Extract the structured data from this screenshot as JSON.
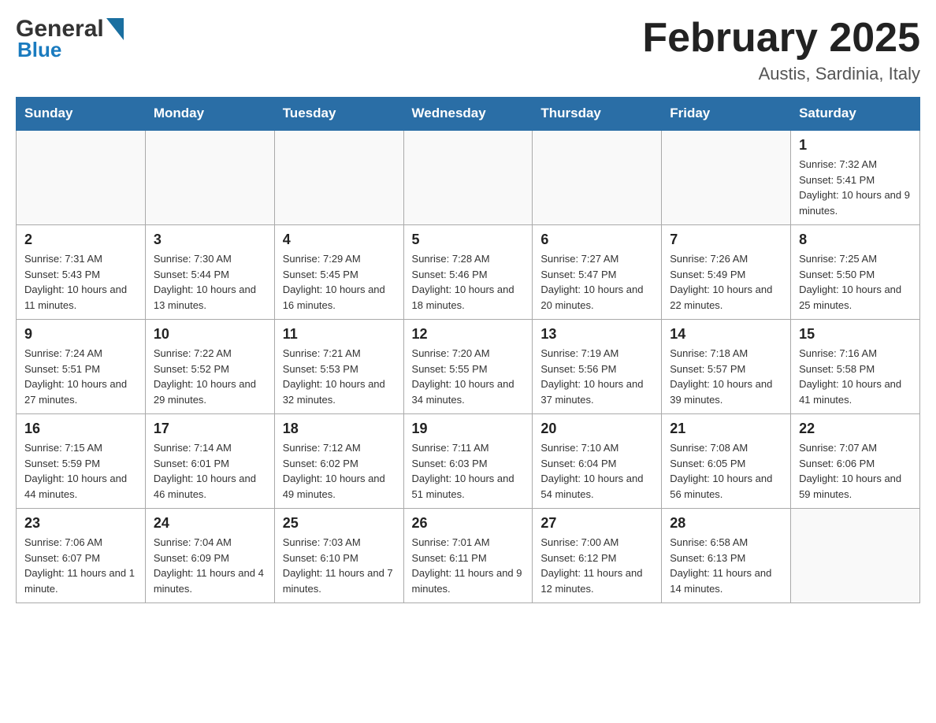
{
  "header": {
    "logo_general": "General",
    "logo_blue": "Blue",
    "month_title": "February 2025",
    "location": "Austis, Sardinia, Italy"
  },
  "weekdays": [
    "Sunday",
    "Monday",
    "Tuesday",
    "Wednesday",
    "Thursday",
    "Friday",
    "Saturday"
  ],
  "weeks": [
    [
      {
        "day": "",
        "info": ""
      },
      {
        "day": "",
        "info": ""
      },
      {
        "day": "",
        "info": ""
      },
      {
        "day": "",
        "info": ""
      },
      {
        "day": "",
        "info": ""
      },
      {
        "day": "",
        "info": ""
      },
      {
        "day": "1",
        "info": "Sunrise: 7:32 AM\nSunset: 5:41 PM\nDaylight: 10 hours and 9 minutes."
      }
    ],
    [
      {
        "day": "2",
        "info": "Sunrise: 7:31 AM\nSunset: 5:43 PM\nDaylight: 10 hours and 11 minutes."
      },
      {
        "day": "3",
        "info": "Sunrise: 7:30 AM\nSunset: 5:44 PM\nDaylight: 10 hours and 13 minutes."
      },
      {
        "day": "4",
        "info": "Sunrise: 7:29 AM\nSunset: 5:45 PM\nDaylight: 10 hours and 16 minutes."
      },
      {
        "day": "5",
        "info": "Sunrise: 7:28 AM\nSunset: 5:46 PM\nDaylight: 10 hours and 18 minutes."
      },
      {
        "day": "6",
        "info": "Sunrise: 7:27 AM\nSunset: 5:47 PM\nDaylight: 10 hours and 20 minutes."
      },
      {
        "day": "7",
        "info": "Sunrise: 7:26 AM\nSunset: 5:49 PM\nDaylight: 10 hours and 22 minutes."
      },
      {
        "day": "8",
        "info": "Sunrise: 7:25 AM\nSunset: 5:50 PM\nDaylight: 10 hours and 25 minutes."
      }
    ],
    [
      {
        "day": "9",
        "info": "Sunrise: 7:24 AM\nSunset: 5:51 PM\nDaylight: 10 hours and 27 minutes."
      },
      {
        "day": "10",
        "info": "Sunrise: 7:22 AM\nSunset: 5:52 PM\nDaylight: 10 hours and 29 minutes."
      },
      {
        "day": "11",
        "info": "Sunrise: 7:21 AM\nSunset: 5:53 PM\nDaylight: 10 hours and 32 minutes."
      },
      {
        "day": "12",
        "info": "Sunrise: 7:20 AM\nSunset: 5:55 PM\nDaylight: 10 hours and 34 minutes."
      },
      {
        "day": "13",
        "info": "Sunrise: 7:19 AM\nSunset: 5:56 PM\nDaylight: 10 hours and 37 minutes."
      },
      {
        "day": "14",
        "info": "Sunrise: 7:18 AM\nSunset: 5:57 PM\nDaylight: 10 hours and 39 minutes."
      },
      {
        "day": "15",
        "info": "Sunrise: 7:16 AM\nSunset: 5:58 PM\nDaylight: 10 hours and 41 minutes."
      }
    ],
    [
      {
        "day": "16",
        "info": "Sunrise: 7:15 AM\nSunset: 5:59 PM\nDaylight: 10 hours and 44 minutes."
      },
      {
        "day": "17",
        "info": "Sunrise: 7:14 AM\nSunset: 6:01 PM\nDaylight: 10 hours and 46 minutes."
      },
      {
        "day": "18",
        "info": "Sunrise: 7:12 AM\nSunset: 6:02 PM\nDaylight: 10 hours and 49 minutes."
      },
      {
        "day": "19",
        "info": "Sunrise: 7:11 AM\nSunset: 6:03 PM\nDaylight: 10 hours and 51 minutes."
      },
      {
        "day": "20",
        "info": "Sunrise: 7:10 AM\nSunset: 6:04 PM\nDaylight: 10 hours and 54 minutes."
      },
      {
        "day": "21",
        "info": "Sunrise: 7:08 AM\nSunset: 6:05 PM\nDaylight: 10 hours and 56 minutes."
      },
      {
        "day": "22",
        "info": "Sunrise: 7:07 AM\nSunset: 6:06 PM\nDaylight: 10 hours and 59 minutes."
      }
    ],
    [
      {
        "day": "23",
        "info": "Sunrise: 7:06 AM\nSunset: 6:07 PM\nDaylight: 11 hours and 1 minute."
      },
      {
        "day": "24",
        "info": "Sunrise: 7:04 AM\nSunset: 6:09 PM\nDaylight: 11 hours and 4 minutes."
      },
      {
        "day": "25",
        "info": "Sunrise: 7:03 AM\nSunset: 6:10 PM\nDaylight: 11 hours and 7 minutes."
      },
      {
        "day": "26",
        "info": "Sunrise: 7:01 AM\nSunset: 6:11 PM\nDaylight: 11 hours and 9 minutes."
      },
      {
        "day": "27",
        "info": "Sunrise: 7:00 AM\nSunset: 6:12 PM\nDaylight: 11 hours and 12 minutes."
      },
      {
        "day": "28",
        "info": "Sunrise: 6:58 AM\nSunset: 6:13 PM\nDaylight: 11 hours and 14 minutes."
      },
      {
        "day": "",
        "info": ""
      }
    ]
  ]
}
